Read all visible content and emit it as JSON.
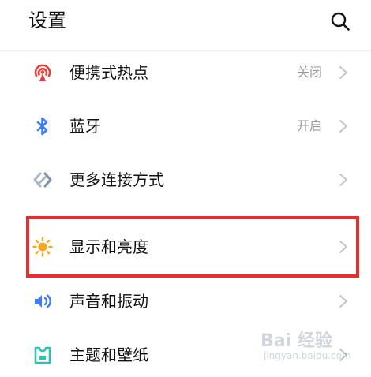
{
  "header": {
    "title": "设置"
  },
  "rows": [
    {
      "label": "便携式热点",
      "status": "关闭",
      "icon": "hotspot-icon"
    },
    {
      "label": "蓝牙",
      "status": "开启",
      "icon": "bluetooth-icon"
    },
    {
      "label": "更多连接方式",
      "status": "",
      "icon": "connection-icon"
    },
    {
      "label": "显示和亮度",
      "status": "",
      "icon": "sun-icon"
    },
    {
      "label": "声音和振动",
      "status": "",
      "icon": "sound-icon"
    },
    {
      "label": "主题和壁纸",
      "status": "",
      "icon": "theme-icon"
    }
  ],
  "highlighted_row": "显示和亮度",
  "colors": {
    "highlight_border": "#ee2b2b",
    "hotspot": "#e8413d",
    "bluetooth": "#3f7bf5",
    "connection": "#a9b6c8",
    "sun": "#f5a623",
    "sound": "#3f7bf5",
    "theme": "#2ec2b0"
  },
  "watermark": {
    "brand": "Bai 经验",
    "url": "jingyan.baidu.com"
  }
}
